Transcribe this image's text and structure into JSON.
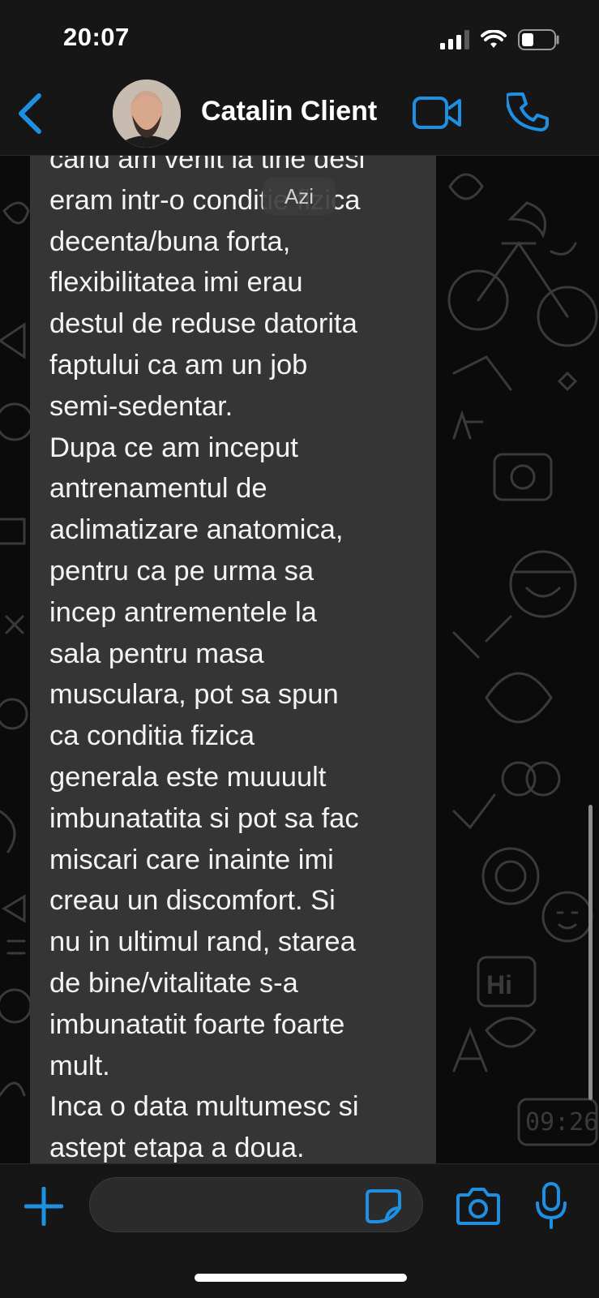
{
  "status_bar": {
    "time": "20:07"
  },
  "header": {
    "contact_name": "Catalin Client"
  },
  "date_separator": "Azi",
  "message": {
    "lines": [
      "cand am venit la tine desi",
      "eram intr-o conditie fizica",
      "decenta/buna forta,",
      "flexibilitatea imi erau",
      "destul de reduse datorita",
      "faptului ca am un job",
      "semi-sedentar.",
      "Dupa ce am inceput",
      "antrenamentul de",
      "aclimatizare anatomica,",
      "pentru ca pe urma sa",
      "incep antrementele la",
      "sala pentru masa",
      "musculara, pot sa spun",
      "ca conditia fizica",
      "generala este muuuult",
      "imbunatatita si pot sa fac",
      "miscari care inainte imi",
      "creau un discomfort. Si",
      "nu in ultimul rand, starea",
      "de bine/vitalitate s-a",
      "imbunatatit foarte foarte",
      "mult.",
      "Inca o data multumesc si",
      "astept etapa a doua."
    ]
  },
  "input_bar": {
    "field_value": ""
  },
  "wallpaper_text": {
    "hi": "Hi",
    "clock": "09:26"
  },
  "colors": {
    "accent": "#1e8fe1",
    "bubble": "#353535",
    "header": "#161616"
  }
}
